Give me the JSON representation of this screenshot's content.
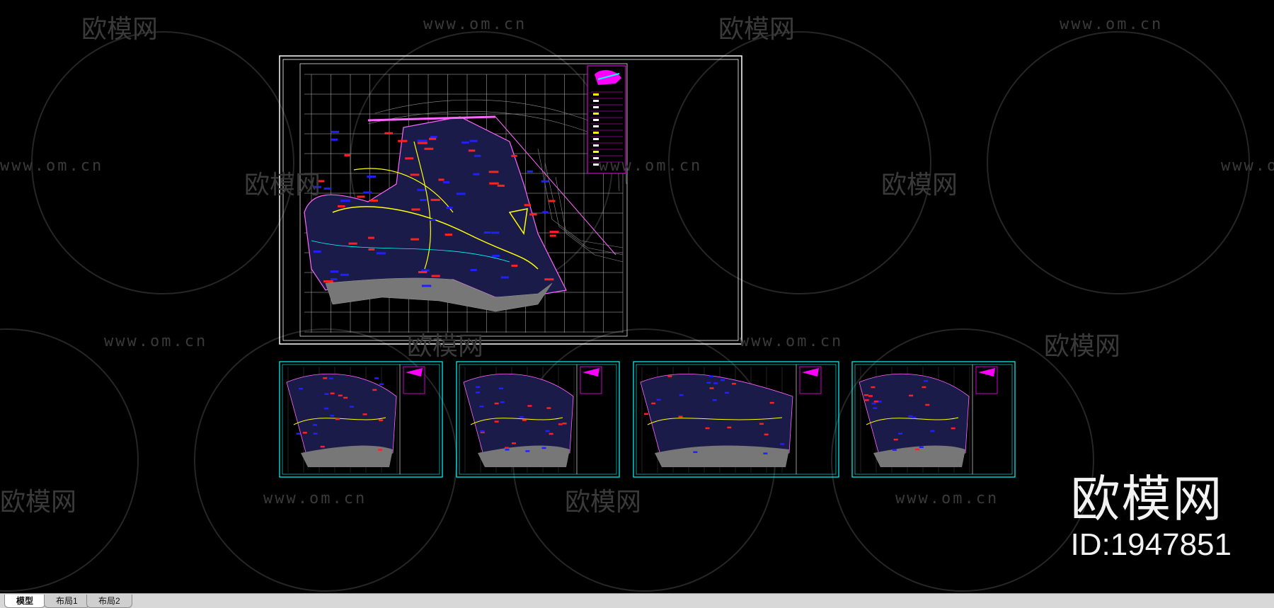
{
  "layout_tabs": [
    {
      "label": "模型",
      "active": true
    },
    {
      "label": "布局1",
      "active": false
    },
    {
      "label": "布局2",
      "active": false
    }
  ],
  "watermark": {
    "brand": "欧模网",
    "url": "www.om.cn",
    "id_text": "ID:1947851"
  },
  "colors": {
    "background": "#000000",
    "frame": "#ffffff",
    "sheet_frame": "#00ffff",
    "contour": "#8c8c8c",
    "roads": "#ffff00",
    "labels_red": "#ff0000",
    "labels_blue": "#0000ff",
    "magenta": "#ff00ff",
    "grid": "#d0d0d0"
  },
  "icons": [
    "sofa-logo-icon"
  ]
}
